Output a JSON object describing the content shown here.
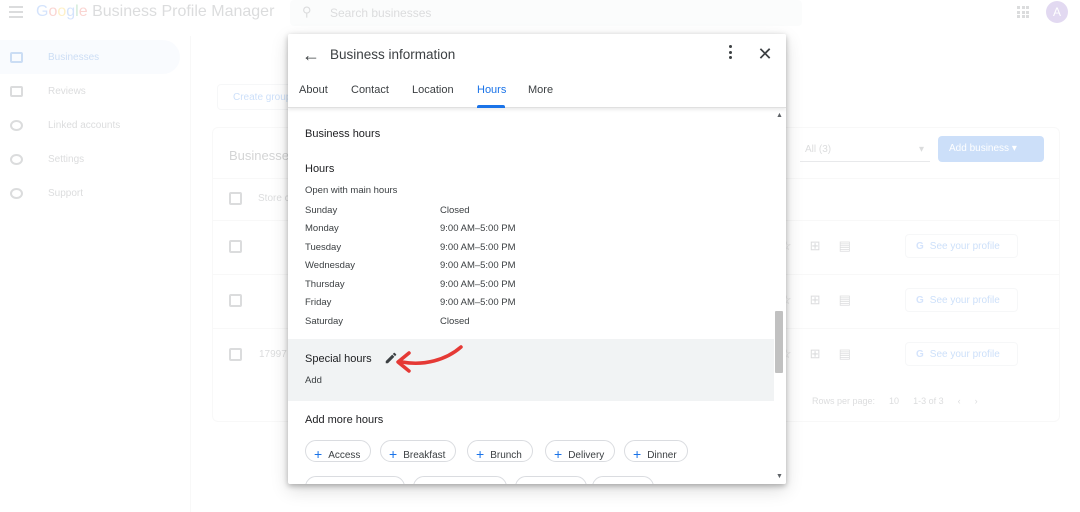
{
  "app": {
    "logo_google": [
      "G",
      "o",
      "o",
      "g",
      "l",
      "e"
    ],
    "logo_rest": "Business Profile Manager",
    "search_placeholder": "Search businesses",
    "avatar_letter": "A"
  },
  "nav": {
    "items": [
      {
        "label": "Businesses",
        "icon": "storefront-icon"
      },
      {
        "label": "Reviews",
        "icon": "reviews-icon"
      },
      {
        "label": "Linked accounts",
        "icon": "link-icon"
      },
      {
        "label": "Settings",
        "icon": "gear-icon"
      },
      {
        "label": "Support",
        "icon": "help-icon"
      }
    ]
  },
  "background": {
    "create_group": "Create group",
    "card_title": "Businesses",
    "filter_value": "All (3)",
    "add_business": "Add business",
    "store_code_header": "Store code",
    "row_id": "17997",
    "see_profile": "See your profile",
    "rows_per_page_label": "Rows per page:",
    "rows_per_page_value": "10",
    "range": "1-3 of 3"
  },
  "dialog": {
    "title": "Business information",
    "tabs": [
      {
        "label": "About"
      },
      {
        "label": "Contact"
      },
      {
        "label": "Location"
      },
      {
        "label": "Hours"
      },
      {
        "label": "More"
      }
    ],
    "active_tab": "Hours",
    "business_hours_title": "Business hours",
    "hours_title": "Hours",
    "hours_subtitle": "Open with main hours",
    "hours": [
      {
        "day": "Sunday",
        "time": "Closed"
      },
      {
        "day": "Monday",
        "time": "9:00 AM–5:00 PM"
      },
      {
        "day": "Tuesday",
        "time": "9:00 AM–5:00 PM"
      },
      {
        "day": "Wednesday",
        "time": "9:00 AM–5:00 PM"
      },
      {
        "day": "Thursday",
        "time": "9:00 AM–5:00 PM"
      },
      {
        "day": "Friday",
        "time": "9:00 AM–5:00 PM"
      },
      {
        "day": "Saturday",
        "time": "Closed"
      }
    ],
    "special_hours_title": "Special hours",
    "special_hours_add": "Add",
    "add_more_title": "Add more hours",
    "chips": [
      {
        "label": "Access"
      },
      {
        "label": "Breakfast"
      },
      {
        "label": "Brunch"
      },
      {
        "label": "Delivery"
      },
      {
        "label": "Dinner"
      }
    ]
  },
  "colors": {
    "accent": "#1a73e8",
    "annotation_arrow": "#e53935"
  }
}
